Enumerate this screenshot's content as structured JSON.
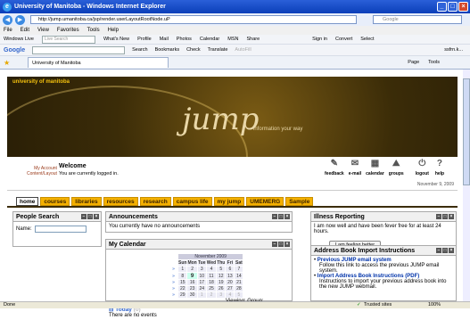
{
  "window": {
    "title": "University of Manitoba - Windows Internet Explorer"
  },
  "address": {
    "url": "http://jump.umanitoba.ca/jsp/render.userLayoutRootNode.uP",
    "search_placeholder": "Google"
  },
  "menu": [
    "File",
    "Edit",
    "View",
    "Favorites",
    "Tools",
    "Help"
  ],
  "links": {
    "items": [
      "Windows Live",
      "Live Search",
      "What's New",
      "Profile",
      "Mail",
      "Photos",
      "Calendar",
      "MSN",
      "Share"
    ],
    "right": [
      "Sign in",
      "Convert",
      "Select"
    ]
  },
  "google": {
    "label": "Google",
    "items": [
      "Search",
      "Bookmarks",
      "Check",
      "Translate",
      "AutoFill"
    ],
    "right": "ssfrn.k..."
  },
  "tab": {
    "title": "University of Manitoba",
    "tools": [
      "Page",
      "Tools"
    ]
  },
  "banner": {
    "university": "university of manitoba",
    "logo": "jump",
    "tagline": "information your way"
  },
  "user": {
    "my_account": "My Account",
    "content_layout": "Content/Layout",
    "welcome": "Welcome",
    "status": "You are currently logged in.",
    "date": "November 9, 2009",
    "icons": [
      {
        "name": "feedback",
        "g": "✎"
      },
      {
        "name": "e-mail",
        "g": "✉"
      },
      {
        "name": "calendar",
        "g": "▦"
      },
      {
        "name": "groups",
        "g": "⛰"
      },
      {
        "name": "logout",
        "g": "⏻"
      },
      {
        "name": "help",
        "g": "?"
      }
    ]
  },
  "nav": [
    {
      "label": "home",
      "active": true
    },
    {
      "label": "courses"
    },
    {
      "label": "libraries"
    },
    {
      "label": "resources"
    },
    {
      "label": "research"
    },
    {
      "label": "campus life"
    },
    {
      "label": "my jump"
    },
    {
      "label": "UMEMERG"
    },
    {
      "label": "Sample"
    }
  ],
  "people": {
    "title": "People Search",
    "name_label": "Name:"
  },
  "announcements": {
    "title": "Announcements",
    "body": "You currently have no announcements"
  },
  "calendar": {
    "title": "My Calendar",
    "month": "November 2009",
    "days": [
      "Sun",
      "Mon",
      "Tue",
      "Wed",
      "Thu",
      "Fri",
      "Sat"
    ],
    "weeks": [
      [
        "1",
        "2",
        "3",
        "4",
        "5",
        "6",
        "7"
      ],
      [
        "8",
        "9",
        "10",
        "11",
        "12",
        "13",
        "14"
      ],
      [
        "15",
        "16",
        "17",
        "18",
        "19",
        "20",
        "21"
      ],
      [
        "22",
        "23",
        "24",
        "25",
        "26",
        "27",
        "28"
      ],
      [
        "29",
        "30",
        "1",
        "2",
        "3",
        "4",
        "5"
      ]
    ],
    "view_label": "Viewing:",
    "group_label": "Group:",
    "today": "Today",
    "today_count": "(0)",
    "no_events": "There are no events"
  },
  "illness": {
    "title": "Illness Reporting",
    "body": "I am now well and have been fever free for at least 24 hours.",
    "button": "I am feeling better"
  },
  "address_book": {
    "title": "Address Book Import Instructions",
    "items": [
      {
        "link": "Previous JUMP email system",
        "desc": "Follow this link to access the previous JUMP email system."
      },
      {
        "link": "Import Address Book Instructions (PDF)",
        "desc": "Instructions to import your previous address book into the new JUMP webmail."
      }
    ]
  },
  "status": {
    "left": "Done",
    "zone": "Trusted sites",
    "zoom": "100%"
  }
}
